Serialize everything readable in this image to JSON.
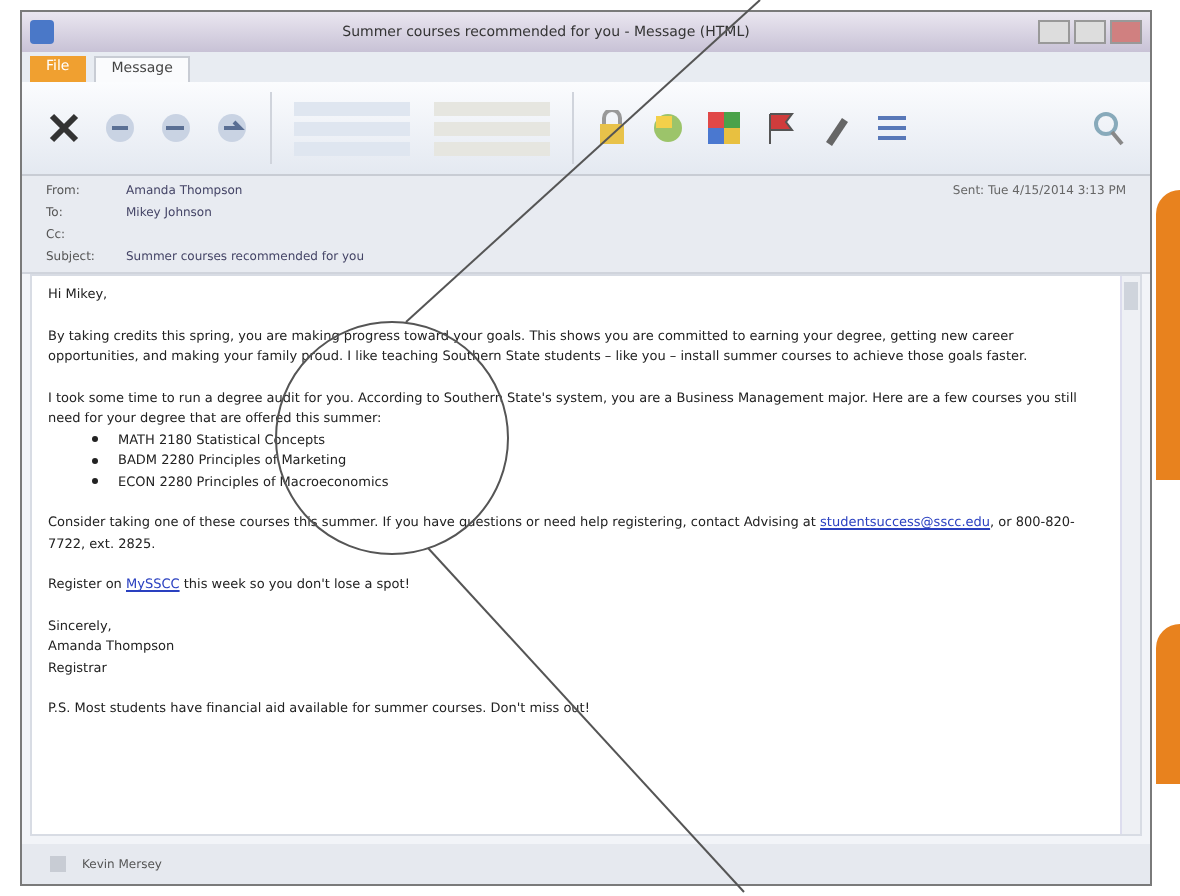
{
  "window": {
    "title": "Summer courses recommended for you - Message (HTML)"
  },
  "tabs": [
    {
      "label": "File",
      "selected": false,
      "kind": "file"
    },
    {
      "label": "Message",
      "selected": true,
      "kind": "tab"
    }
  ],
  "header": {
    "fields": [
      {
        "label": "From:",
        "value": "Amanda Thompson"
      },
      {
        "label": "To:",
        "value": "Mikey Johnson"
      },
      {
        "label": "Cc:"
      },
      {
        "label": "Subject:",
        "value": "Summer courses recommended for you"
      }
    ],
    "sent": "Sent: Tue 4/15/2014 3:13 PM"
  },
  "body": {
    "greeting": "Hi Mikey,",
    "paragraphs": [
      "By taking credits this spring, you are making progress toward your goals. This shows you are committed to earning your degree, getting new career opportunities, and making your family proud. I like teaching Southern State students – like you – install summer courses to achieve those goals faster.",
      "I took some time to run a degree audit for you. According to Southern State's system, you are a Business Management major. Here are a few courses you still need for your degree that are offered this summer:"
    ],
    "courses": [
      "MATH 2180 Statistical Concepts",
      "BADM 2280 Principles of Marketing",
      "ECON 2280 Principles of Macroeconomics"
    ],
    "contact": {
      "before": "Consider taking one of these courses this summer. If you have questions or need help registering, contact Advising at",
      "link": "studentsuccess@sscc.edu",
      "after": ", or 800-820-7722, ext. 2825."
    },
    "register": {
      "before": "Register on",
      "link": "MySSCC",
      "after": "this week so you don't lose a spot!"
    },
    "signature": [
      "Sincerely,",
      "Amanda Thompson",
      "Registrar"
    ],
    "postscript": "P.S. Most students have financial aid available for summer courses. Don't miss out!"
  },
  "status_bar": {
    "text": "Kevin Mersey"
  }
}
